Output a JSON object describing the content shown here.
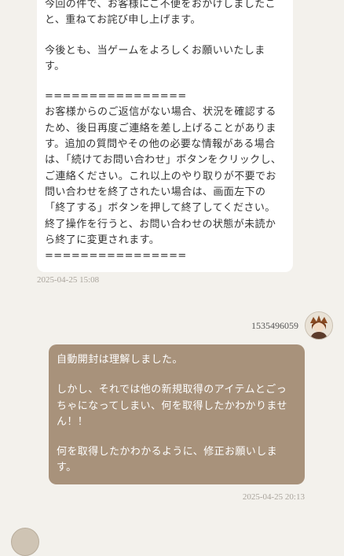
{
  "support_message": {
    "paragraphs": [
      "今回の件で、お客様にご不便をおかけしましたこと、重ねてお詫び申し上げます。",
      "今後とも、当ゲームをよろしくお願いいたします。",
      "================\nお客様からのご返信がない場合、状況を確認するため、後日再度ご連絡を差し上げることがあります。追加の質問やその他の必要な情報がある場合は、「続けてお問い合わせ」ボタンをクリックし、ご連絡ください。これ以上のやり取りが不要でお問い合わせを終了されたい場合は、画面左下の「終了する」ボタンを押して終了してください。終了操作を行うと、お問い合わせの状態が未読から終了に変更されます。\n================"
    ],
    "timestamp": "2025-04-25 15:08"
  },
  "user_message": {
    "user_id": "1535496059",
    "paragraphs": [
      "自動開封は理解しました。",
      "しかし、それでは他の新規取得のアイテムとごっちゃになってしまい、何を取得したかわかりません！！",
      "何を取得したかわかるように、修正お願いします。"
    ],
    "timestamp": "2025-04-25 20:13"
  },
  "colors": {
    "background": "#f3f1ec",
    "support_bubble": "#ffffff",
    "user_bubble": "#a8927b",
    "timestamp": "#a9a49c"
  }
}
